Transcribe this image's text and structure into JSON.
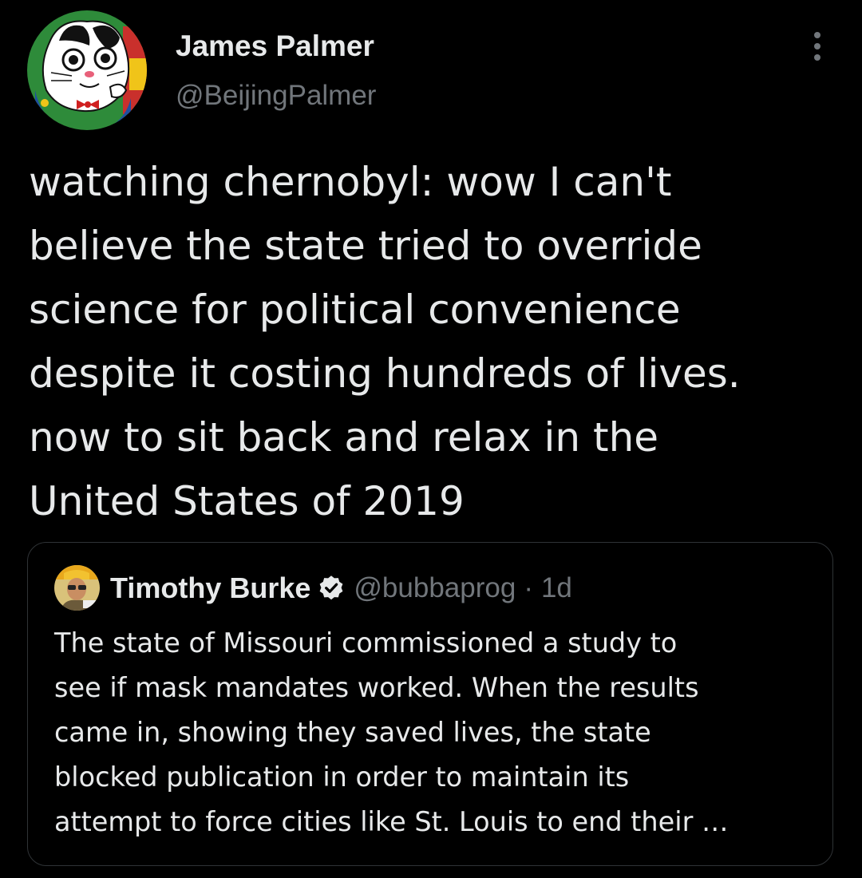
{
  "tweet": {
    "author": {
      "name": "James Palmer",
      "handle": "@BeijingPalmer",
      "avatar_icon": "cartoon-cat-avatar"
    },
    "more_icon": "more-options-icon",
    "text_lines": [
      "watching chernobyl: wow I can't",
      "believe the state tried to override",
      "science for political convenience",
      "despite it costing hundreds of lives.",
      "now to sit back and relax in the",
      "United States of 2019"
    ]
  },
  "quote": {
    "name": "Timothy Burke",
    "verified_icon": "verified-badge-icon",
    "handle": "@bubbaprog",
    "separator": "·",
    "time": "1d",
    "text_lines": [
      "The state of Missouri commissioned a study to",
      "see if mask mandates worked. When the results",
      "came in, showing they saved lives, the state",
      "blocked publication in order to maintain its",
      "attempt to force cities like St. Louis to end their …"
    ]
  },
  "colors": {
    "background": "#000000",
    "primary_text": "#e7e9ea",
    "secondary_text": "#71767b",
    "border": "#2f3336"
  }
}
